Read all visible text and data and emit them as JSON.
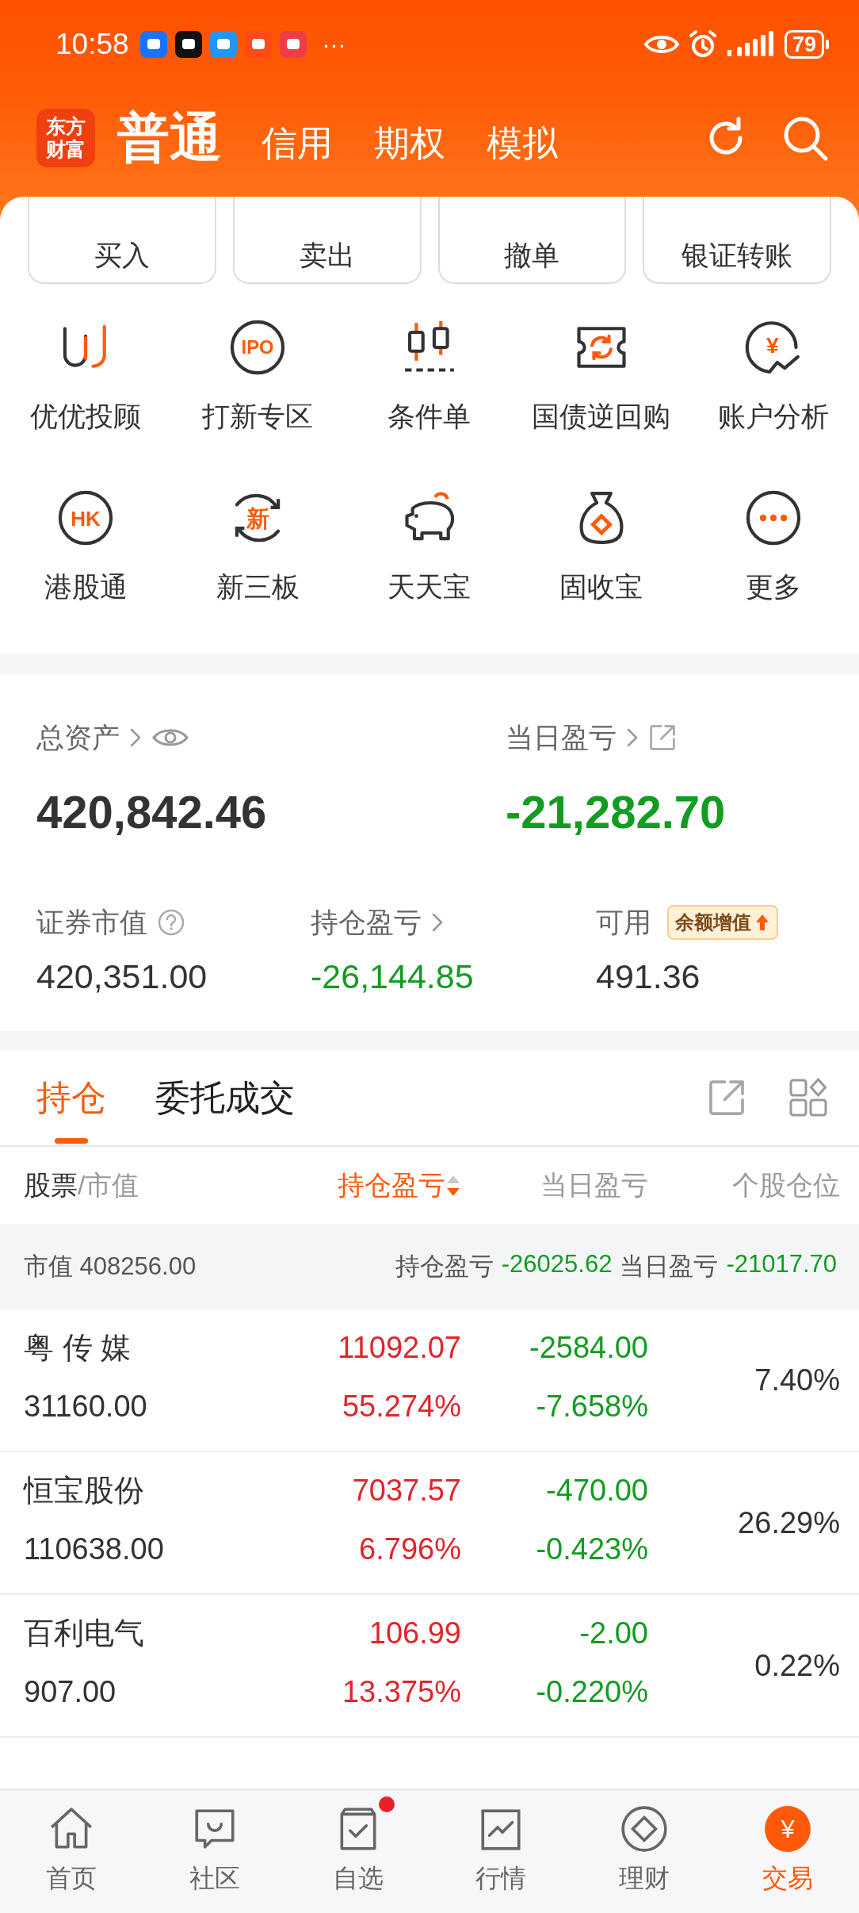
{
  "status_bar": {
    "time": "10:58",
    "more": "···",
    "battery": "79"
  },
  "header": {
    "logo": "东方财富",
    "tabs": [
      {
        "label": "普通",
        "selected": true
      },
      {
        "label": "信用",
        "selected": false
      },
      {
        "label": "期权",
        "selected": false
      },
      {
        "label": "模拟",
        "selected": false
      }
    ]
  },
  "action_buttons": [
    "买入",
    "卖出",
    "撤单",
    "银证转账"
  ],
  "features": [
    {
      "label": "优优投顾",
      "kind": "uu"
    },
    {
      "label": "打新专区",
      "kind": "ipo",
      "icon_text": "IPO"
    },
    {
      "label": "条件单",
      "kind": "candles"
    },
    {
      "label": "国债逆回购",
      "kind": "repo"
    },
    {
      "label": "账户分析",
      "kind": "analysis",
      "icon_text": "¥"
    },
    {
      "label": "港股通",
      "kind": "hk",
      "icon_text": "HK"
    },
    {
      "label": "新三板",
      "kind": "xin",
      "icon_text": "新"
    },
    {
      "label": "天天宝",
      "kind": "piggy"
    },
    {
      "label": "固收宝",
      "kind": "bag"
    },
    {
      "label": "更多",
      "kind": "more"
    }
  ],
  "assets": {
    "total": {
      "label": "总资产",
      "value": "420,842.46",
      "color": "#333333"
    },
    "daily": {
      "label": "当日盈亏",
      "value": "-21,282.70",
      "color": "#129c22"
    },
    "stats": [
      {
        "label": "证券市值",
        "value": "420,351.00",
        "color": "#333333",
        "kind": "help"
      },
      {
        "label": "持仓盈亏",
        "value": "-26,144.85",
        "color": "#129c22",
        "kind": "link"
      },
      {
        "label": "可用",
        "value": "491.36",
        "color": "#333333",
        "kind": "promo",
        "badge": "余额增值"
      }
    ]
  },
  "holdings": {
    "tabs": [
      {
        "label": "持仓",
        "selected": true
      },
      {
        "label": "委托成交",
        "selected": false
      }
    ],
    "columns": [
      {
        "label": "股票",
        "suffix": "/市值",
        "selected": false
      },
      {
        "label": "持仓盈亏",
        "selected": true,
        "sort_descending": true
      },
      {
        "label": "当日盈亏",
        "selected": false
      },
      {
        "label": "个股仓位",
        "selected": false
      }
    ],
    "summary": {
      "value_label": "市值",
      "value": "408256.00",
      "pnl": {
        "label": "持仓盈亏",
        "value": "-26025.62",
        "color": "#129c22"
      },
      "daily": {
        "label": "当日盈亏",
        "value": "-21017.70",
        "color": "#129c22"
      }
    },
    "rows": [
      {
        "name": "粤 传 媒",
        "market_value": "31160.00",
        "pnl": {
          "amount": "11092.07",
          "percent": "55.274%",
          "color": "#e0262c"
        },
        "daily": {
          "amount": "-2584.00",
          "percent": "-7.658%",
          "color": "#129c22"
        },
        "weight": "7.40%"
      },
      {
        "name": "恒宝股份",
        "market_value": "110638.00",
        "pnl": {
          "amount": "7037.57",
          "percent": "6.796%",
          "color": "#e0262c"
        },
        "daily": {
          "amount": "-470.00",
          "percent": "-0.423%",
          "color": "#129c22"
        },
        "weight": "26.29%"
      },
      {
        "name": "百利电气",
        "market_value": "907.00",
        "pnl": {
          "amount": "106.99",
          "percent": "13.375%",
          "color": "#e0262c"
        },
        "daily": {
          "amount": "-2.00",
          "percent": "-0.220%",
          "color": "#129c22"
        },
        "weight": "0.22%"
      }
    ]
  },
  "bottom_nav": [
    {
      "label": "首页",
      "kind": "home",
      "selected": false,
      "notification": false
    },
    {
      "label": "社区",
      "kind": "chat",
      "selected": false,
      "notification": false
    },
    {
      "label": "自选",
      "kind": "watch",
      "selected": false,
      "notification": true
    },
    {
      "label": "行情",
      "kind": "chart",
      "selected": false,
      "notification": false
    },
    {
      "label": "理财",
      "kind": "wealth",
      "selected": false,
      "notification": false
    },
    {
      "label": "交易",
      "kind": "trade",
      "selected": true,
      "notification": false,
      "icon_text": "¥"
    }
  ]
}
